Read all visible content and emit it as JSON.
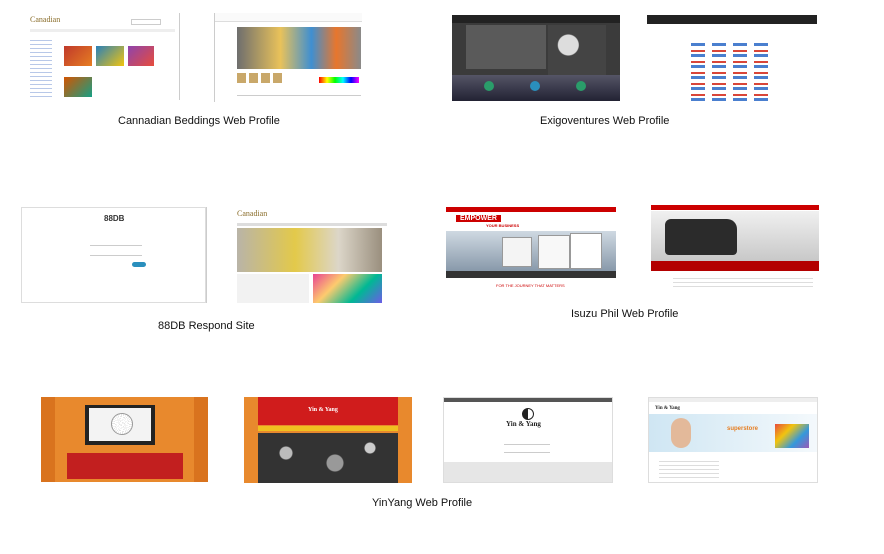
{
  "captions": {
    "canadian": "Cannadian Beddings  Web Profile",
    "exigo": "Exigoventures Web Profile",
    "respond": "88DB Respond Site",
    "isuzu": "Isuzu Phil  Web Profile",
    "yinyang": "YinYang  Web Profile"
  },
  "thumbs": {
    "canadian_logo": "Canadian",
    "canadian_logo2": "Canadian",
    "respond_logo": "88DB",
    "isuzu_banner": "EMPOWER",
    "isuzu_banner_sub": "YOUR BUSINESS",
    "isuzu_footer": "FOR THE JOURNEY THAT MATTERS",
    "yinyang_logo": "Yin & Yang",
    "yinyang_logo2": "Yin & Yang",
    "yinyang_logo3": "Yin & Yang",
    "superstore": "superstore"
  }
}
